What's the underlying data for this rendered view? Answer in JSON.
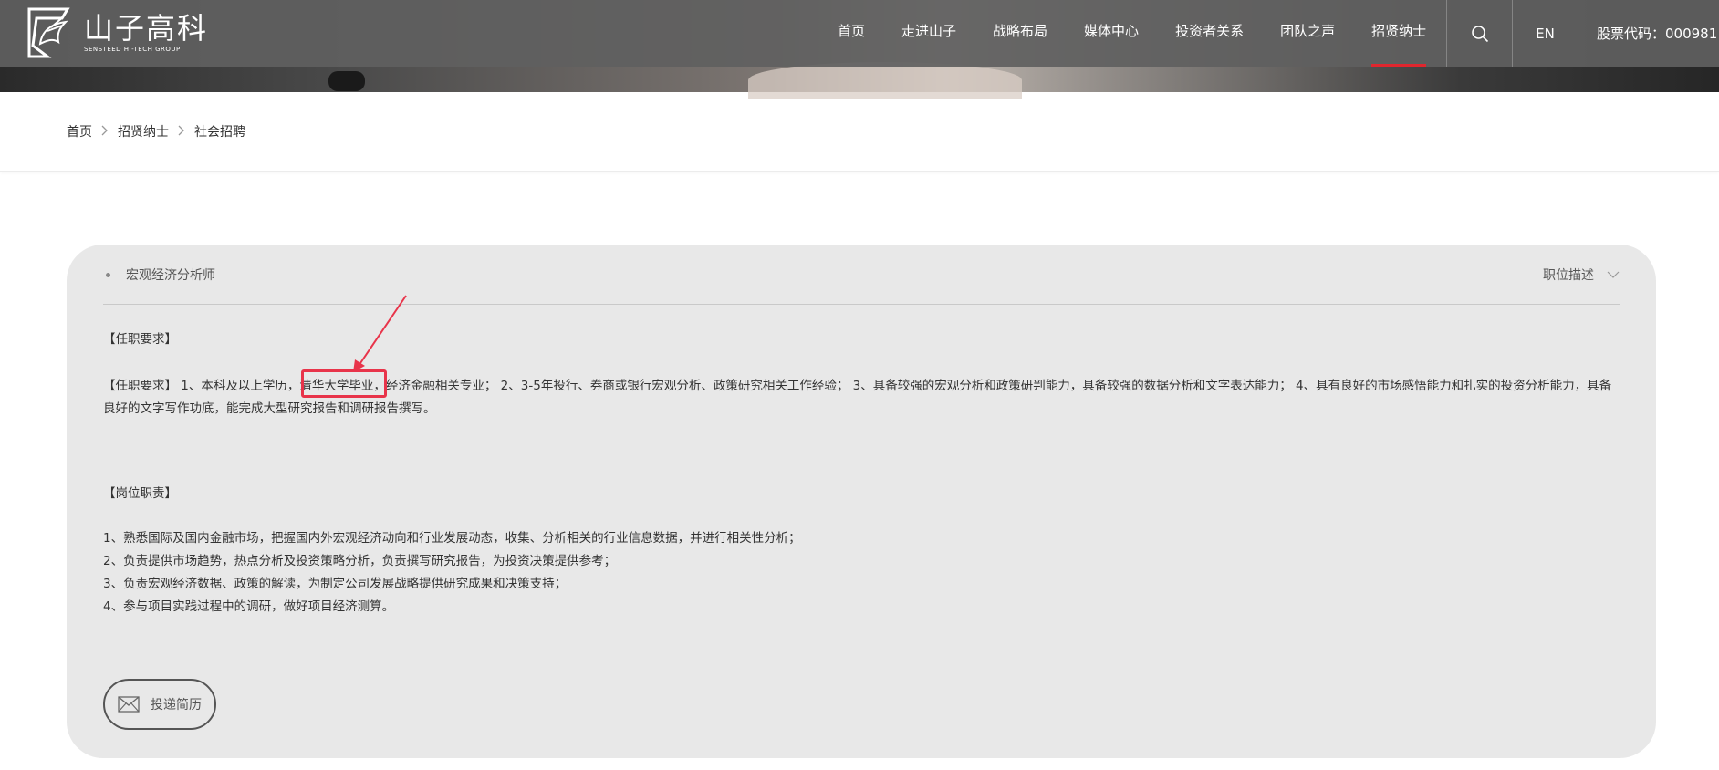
{
  "logo": {
    "cn": "山子高科",
    "en": "SENSTEED HI-TECH GROUP"
  },
  "nav": [
    {
      "label": "首页",
      "active": false
    },
    {
      "label": "走进山子",
      "active": false
    },
    {
      "label": "战略布局",
      "active": false
    },
    {
      "label": "媒体中心",
      "active": false
    },
    {
      "label": "投资者关系",
      "active": false
    },
    {
      "label": "团队之声",
      "active": false
    },
    {
      "label": "招贤纳士",
      "active": true
    }
  ],
  "header": {
    "lang": "EN",
    "stock": "股票代码：000981"
  },
  "breadcrumb": [
    "首页",
    "招贤纳士",
    "社会招聘"
  ],
  "job": {
    "title": "宏观经济分析师",
    "toggle_label": "职位描述",
    "requirements_heading": "【任职要求】",
    "requirements_lead": "【任职要求】",
    "requirements_pre": " 1、本科及以上学历，",
    "requirements_highlight": "清华大学毕业",
    "requirements_post": "，经济金融相关专业； 2、3-5年投行、券商或银行宏观分析、政策研究相关工作经验； 3、具备较强的宏观分析和政策研判能力，具备较强的数据分析和文字表达能力； 4、具有良好的市场感悟能力和扎实的投资分析能力，具备良好的文字写作功底，能完成大型研究报告和调研报告撰写。",
    "duties_heading": "【岗位职责】",
    "duties": [
      "1、熟悉国际及国内金融市场，把握国内外宏观经济动向和行业发展动态，收集、分析相关的行业信息数据，并进行相关性分析；",
      "2、负责提供市场趋势，热点分析及投资策略分析，负责撰写研究报告，为投资决策提供参考；",
      "3、负责宏观经济数据、政策的解读，为制定公司发展战略提供研究成果和决策支持；",
      "4、参与项目实践过程中的调研，做好项目经济测算。"
    ],
    "apply_label": "投递简历"
  },
  "colors": {
    "accent": "#e0262e",
    "annotation": "#e8344a",
    "card_bg": "#e8e8e8",
    "header_bg": "#606060"
  },
  "icons": [
    "sensteed-logo-icon",
    "search-icon",
    "chevron-right-icon",
    "chevron-down-icon",
    "mail-icon"
  ]
}
